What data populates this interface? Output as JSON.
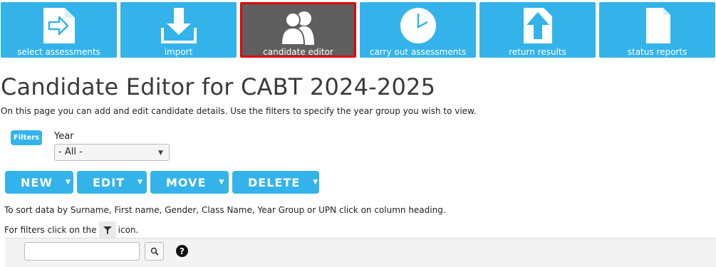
{
  "tiles": [
    {
      "label": "select assessments",
      "icon": "select-assessments-icon"
    },
    {
      "label": "import",
      "icon": "import-icon"
    },
    {
      "label": "candidate editor",
      "icon": "candidates-icon"
    },
    {
      "label": "carry out assessments",
      "icon": "clock-icon"
    },
    {
      "label": "return results",
      "icon": "upload-icon"
    },
    {
      "label": "status reports",
      "icon": "document-icon"
    }
  ],
  "page": {
    "title": "Candidate Editor for CABT 2024-2025",
    "intro": "On this page you can add and edit candidate details. Use the filters to specify the year group you wish to view."
  },
  "filters": {
    "badge": "Filters",
    "year_label": "Year",
    "year_value": "- All -"
  },
  "actions": {
    "new": "NEW",
    "edit": "EDIT",
    "move": "MOVE",
    "delete": "DELETE"
  },
  "notes": {
    "sort": "To sort data by Surname, First name, Gender, Class Name, Year Group or UPN click on column heading.",
    "filter_before": "For filters click on the",
    "filter_after": "icon."
  },
  "toolbar": {
    "search_placeholder": "",
    "help_glyph": "?"
  },
  "colors": {
    "accent": "#33b3ea",
    "active_tile": "#5f5f5f",
    "active_border": "#e00000"
  }
}
